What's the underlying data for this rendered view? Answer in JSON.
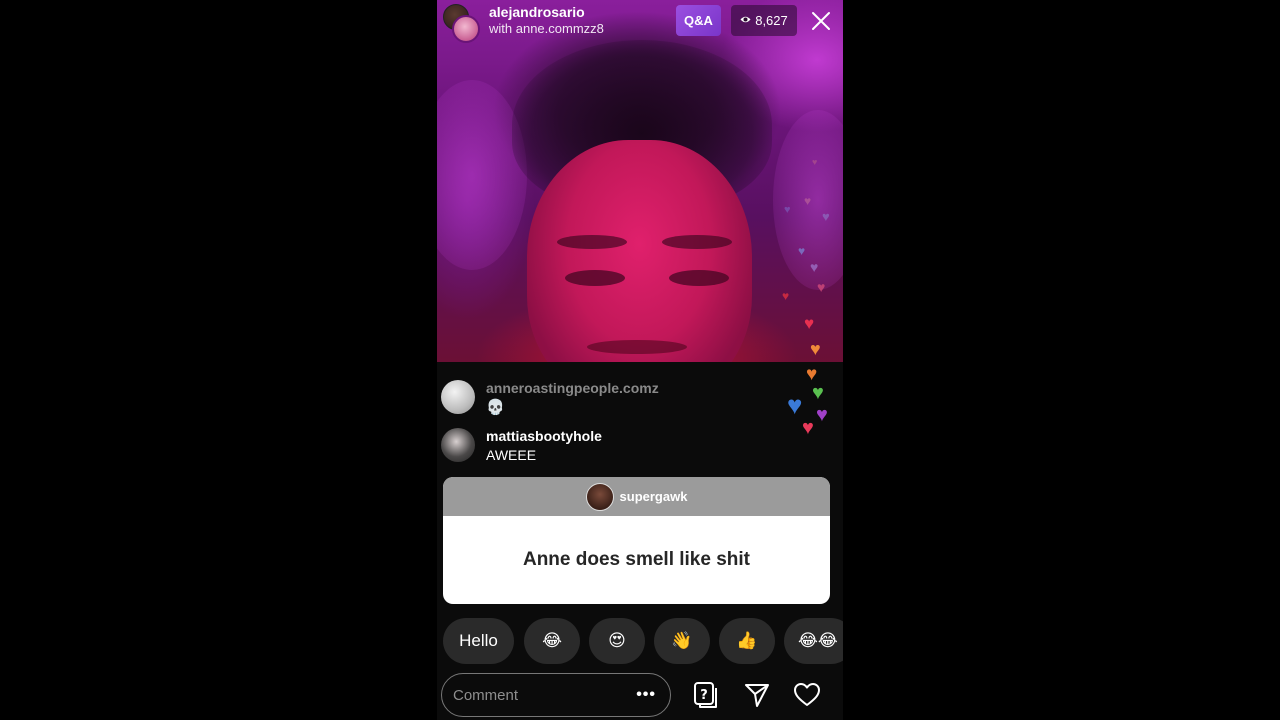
{
  "header": {
    "host_username": "alejandrosario",
    "guest_line": "with anne.commzz8",
    "qa_label": "Q&A",
    "viewer_count": "8,627",
    "viewer_icon": "eye-icon",
    "close_icon": "close-icon"
  },
  "comments": [
    {
      "username": "anneroastingpeople.comz",
      "text": "💀"
    },
    {
      "username": "mattiasbootyhole",
      "text": "AWEEE"
    }
  ],
  "question_card": {
    "asker": "supergawk",
    "question": "Anne does smell like shit"
  },
  "quick_reactions": [
    "Hello",
    "😂",
    "😍",
    "👋",
    "👍",
    "😂😂"
  ],
  "comment_bar": {
    "placeholder": "Comment",
    "more_label": "•••",
    "icons": [
      "question-icon",
      "send-icon",
      "heart-icon"
    ]
  },
  "colors": {
    "qa_badge": "#8a40d6",
    "card_header": "#9b9b9b",
    "background": "#000000"
  }
}
